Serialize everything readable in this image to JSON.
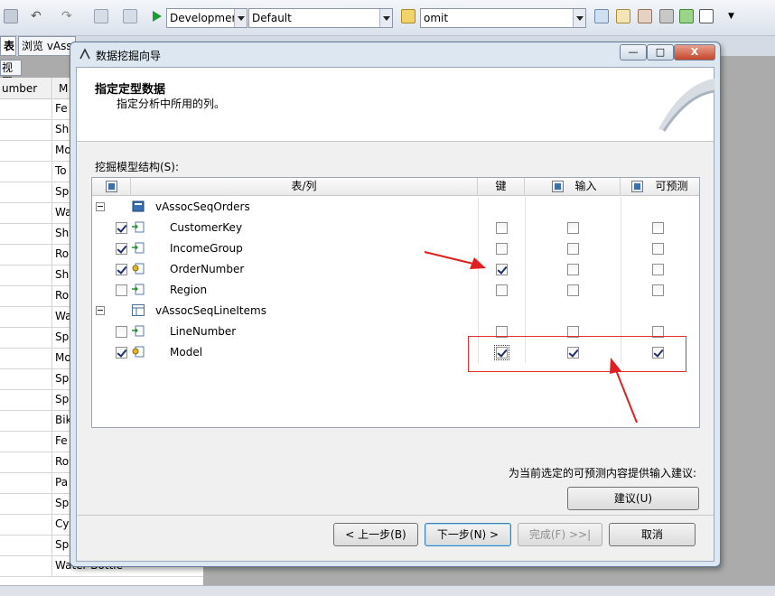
{
  "toolbar": {
    "config_combo": "Developmer",
    "platform_combo": "Default",
    "search_combo": "omit"
  },
  "tabs": {
    "table_tab": "表",
    "browse_tab": "浏览 vAss",
    "view_subtab": "视图"
  },
  "background_grid": {
    "col1_header": "umber",
    "col2_header": "M",
    "rows": [
      "Fe",
      "Sh",
      "Mo",
      "To",
      "Sp",
      "Wa",
      "Sh",
      "Ro",
      "Sh",
      "Ro",
      "Wa",
      "Sp",
      "Mo",
      "Sp",
      "Sp",
      "Bik",
      "Fe",
      "Ro",
      "Pa",
      "Sp",
      "Cy",
      "Sp",
      "Water Bottle"
    ]
  },
  "dialog": {
    "title": "数据挖掘向导",
    "minimize_label": "—",
    "maximize_label": "□",
    "close_label": "X",
    "header_title": "指定定型数据",
    "header_subtitle": "指定分析中所用的列。",
    "structure_label": "挖掘模型结构(S):",
    "columns": {
      "table_col": "表/列",
      "key": "键",
      "input": "输入",
      "predictable": "可预测"
    },
    "rows": [
      {
        "name": "vAssocSeqOrders",
        "kind": "table",
        "include": null,
        "key": null,
        "input": null,
        "predict": null
      },
      {
        "name": "CustomerKey",
        "kind": "column",
        "include": true,
        "key": false,
        "input": false,
        "predict": false
      },
      {
        "name": "IncomeGroup",
        "kind": "column",
        "include": true,
        "key": false,
        "input": false,
        "predict": false
      },
      {
        "name": "OrderNumber",
        "kind": "key-column",
        "include": true,
        "key": true,
        "input": false,
        "predict": false
      },
      {
        "name": "Region",
        "kind": "column",
        "include": false,
        "key": false,
        "input": false,
        "predict": false
      },
      {
        "name": "vAssocSeqLineItems",
        "kind": "table",
        "include": null,
        "key": null,
        "input": null,
        "predict": null
      },
      {
        "name": "LineNumber",
        "kind": "column",
        "include": false,
        "key": false,
        "input": false,
        "predict": false
      },
      {
        "name": "Model",
        "kind": "key-column",
        "include": true,
        "key": true,
        "input": true,
        "predict": true
      }
    ],
    "suggest_label": "为当前选定的可预测内容提供输入建议:",
    "suggest_button": "建议(U)",
    "back_button": "< 上一步(B)",
    "next_button": "下一步(N) >",
    "finish_button": "完成(F) >>|",
    "cancel_button": "取消"
  },
  "colors": {
    "annotation_red": "#e02020",
    "dialog_frame": "#dce7f2",
    "window_bg": "#f0f0f0"
  }
}
